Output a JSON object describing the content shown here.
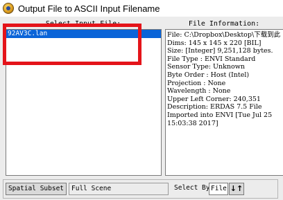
{
  "window": {
    "title": "Output File to ASCII Input Filename",
    "icon": "envi-globe-icon"
  },
  "left_panel": {
    "header": "Select Input File:",
    "files": [
      "92AV3C.lan"
    ],
    "selected_index": 0
  },
  "right_panel": {
    "header": "File Information:",
    "lines": [
      "File: C:\\Dropbox\\Desktop\\下载到此",
      "Dims: 145 x 145 x 220 [BIL]",
      "Size: [Integer] 9,251,128 bytes.",
      "File Type  : ENVI Standard",
      "Sensor Type: Unknown",
      "Byte Order : Host (Intel)",
      "Projection : None",
      "Wavelength : None",
      "Upper Left Corner: 240,351",
      "Description: ERDAS 7.5 File",
      "Imported into ENVI [Tue Jul 25",
      "15:03:38 2017]"
    ]
  },
  "bottom": {
    "spatial_subset_label": "Spatial Subset",
    "spatial_subset_value": "Full Scene",
    "select_by_label": "Select By",
    "select_by_value": "File",
    "sort_icon": "sort-arrows-icon",
    "sort_glyph": "↓↑"
  },
  "colors": {
    "selection": "#0a64d8",
    "highlight": "#e4141a",
    "dialog_bg": "#ececec"
  }
}
